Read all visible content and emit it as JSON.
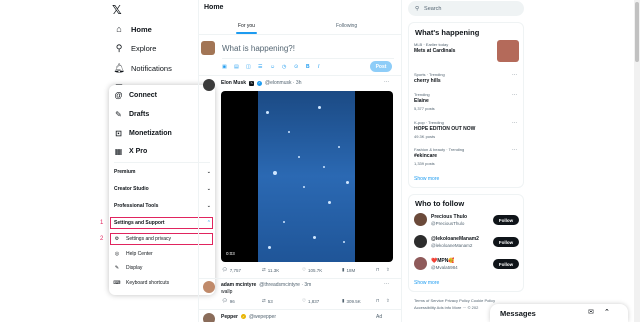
{
  "nav": {
    "logo": "𝕏",
    "items": [
      {
        "label": "Home",
        "icon": "home-icon"
      },
      {
        "label": "Explore",
        "icon": "search-icon"
      },
      {
        "label": "Notifications",
        "icon": "bell-icon"
      },
      {
        "label": "Messages",
        "icon": "mail-icon"
      }
    ]
  },
  "menu": {
    "primary": [
      "Connect",
      "Drafts",
      "Monetization",
      "X Pro"
    ],
    "sections": [
      "Premium",
      "Creator Studio",
      "Professional Tools",
      "Settings and Support"
    ],
    "sub": [
      "Settings and privacy",
      "Help Center",
      "Display",
      "Keyboard shortcuts"
    ],
    "annotations": [
      "1",
      "2"
    ]
  },
  "center": {
    "title": "Home",
    "tabs": [
      "For you",
      "Following"
    ],
    "compose_placeholder": "What is happening?!",
    "post_button": "Post",
    "tweet1": {
      "author": "Elon Musk",
      "handle_time": "@elonmusk · 3h",
      "video_time": "0:03",
      "replies": "7,757",
      "reposts": "11.3K",
      "likes": "105.7K",
      "views": "18M"
    },
    "tweet2": {
      "author": "adam mcintyre",
      "handle_time": "@threadsmcintyre · 3m",
      "text": "wallp",
      "replies": "96",
      "reposts": "53",
      "likes": "1,837",
      "views": "309.5K"
    },
    "tweet3": {
      "author": "Pepper",
      "handle_time": "@wepepper",
      "ad": "Ad"
    }
  },
  "right": {
    "search_placeholder": "Search",
    "whats_happening": {
      "title": "What's happening",
      "trends": [
        {
          "meta": "MLB · Earlier today",
          "title": "Mets at Cardinals",
          "count": ""
        },
        {
          "meta": "Sports · Trending",
          "title": "cherry hills",
          "count": ""
        },
        {
          "meta": "Trending",
          "title": "Elaine",
          "count": "5,377 posts"
        },
        {
          "meta": "K-pop · Trending",
          "title": "HOPE EDITION OUT NOW",
          "count": "49.3K posts"
        },
        {
          "meta": "Fashion & beauty · Trending",
          "title": "#ekincare",
          "count": "1,339 posts"
        }
      ],
      "show_more": "Show more"
    },
    "who_to_follow": {
      "title": "Who to follow",
      "people": [
        {
          "name": "Precious Thulo",
          "handle": "@PreciousThulo"
        },
        {
          "name": "@lekoloaneManam2",
          "handle": "@lekoloaneManam2"
        },
        {
          "name": "❤️MPN🥰",
          "handle": "@Mvala5984"
        }
      ],
      "follow_label": "Follow",
      "show_more": "Show more"
    },
    "footer": [
      "Terms of Service  Privacy Policy  Cookie Policy",
      "Accessibility  Ads info  More ···  © 202"
    ],
    "messages": "Messages"
  }
}
